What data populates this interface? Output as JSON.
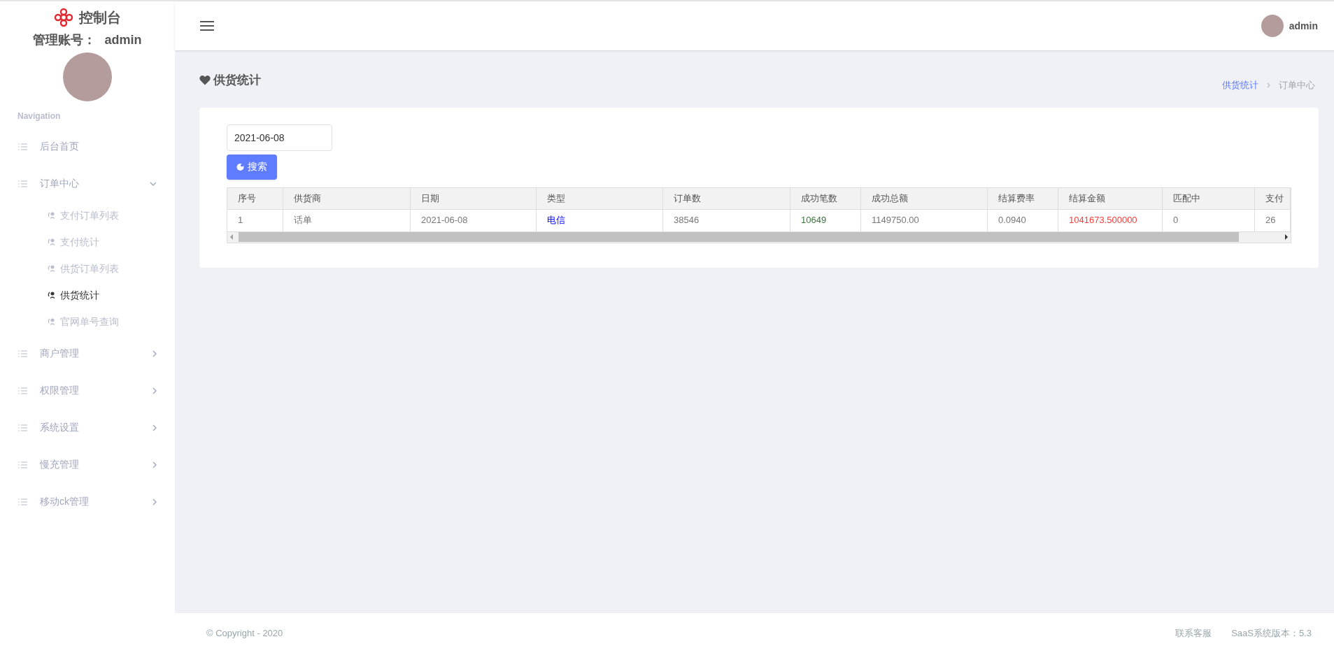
{
  "sidebar": {
    "brand": "控制台",
    "account_label": "管理账号：",
    "account_name": "admin",
    "section_title": "Navigation",
    "items": [
      {
        "kind": "link",
        "label": "后台首页"
      },
      {
        "kind": "group",
        "label": "订单中心",
        "expanded": true,
        "children": [
          {
            "label": "支付订单列表",
            "selected": false
          },
          {
            "label": "支付统计",
            "selected": false
          },
          {
            "label": "供货订单列表",
            "selected": false
          },
          {
            "label": "供货统计",
            "selected": true
          },
          {
            "label": "官网单号查询",
            "selected": false
          }
        ]
      },
      {
        "kind": "group",
        "label": "商户管理",
        "expanded": false
      },
      {
        "kind": "group",
        "label": "权限管理",
        "expanded": false
      },
      {
        "kind": "group",
        "label": "系统设置",
        "expanded": false
      },
      {
        "kind": "group",
        "label": "慢充管理",
        "expanded": false
      },
      {
        "kind": "group",
        "label": "移动ck管理",
        "expanded": false
      }
    ]
  },
  "header": {
    "user_name": "admin"
  },
  "page": {
    "title": "供货统计",
    "breadcrumb": [
      {
        "label": "供货统计",
        "selected": true
      },
      {
        "label": "订单中心",
        "selected": false
      }
    ]
  },
  "filter": {
    "date_value": "2021-06-08",
    "search_button": "搜索"
  },
  "table": {
    "columns": [
      "序号",
      "供货商",
      "日期",
      "类型",
      "订单数",
      "成功笔数",
      "成功总额",
      "结算费率",
      "结算金额",
      "匹配中",
      "支付"
    ],
    "rows": [
      {
        "cells": [
          {
            "text": "1"
          },
          {
            "text": "话单"
          },
          {
            "text": "2021-06-08"
          },
          {
            "text": "电信",
            "color": "#0000ff"
          },
          {
            "text": "38546"
          },
          {
            "text": "10649",
            "color": "#3c763d"
          },
          {
            "text": "1149750.00"
          },
          {
            "text": "0.0940"
          },
          {
            "text": "1041673.500000",
            "color": "#ff3b3b"
          },
          {
            "text": "0"
          },
          {
            "text": "26"
          }
        ]
      }
    ]
  },
  "footer": {
    "copyright": "© Copyright - 2020",
    "links": [
      "联系客服",
      "SaaS系统版本：5.3"
    ]
  }
}
